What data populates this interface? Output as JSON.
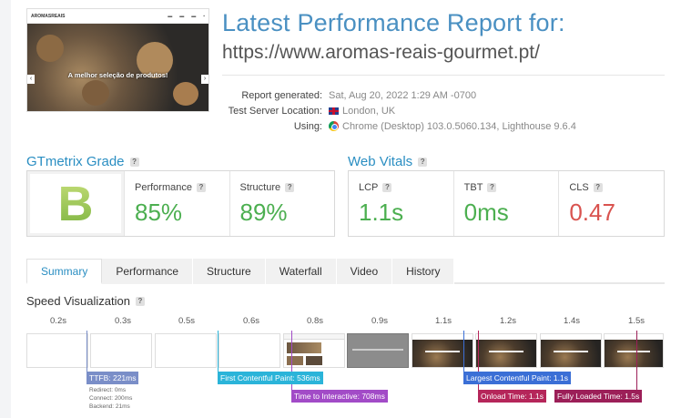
{
  "thumbnail": {
    "logo": "AROMASREAIS",
    "nav_links": [
      "",
      "",
      ""
    ],
    "hero_text": "A melhor seleção de produtos!"
  },
  "header": {
    "title": "Latest Performance Report for:",
    "url": "https://www.aromas-reais-gourmet.pt/"
  },
  "meta": {
    "report_generated_label": "Report generated:",
    "report_generated_value": "Sat, Aug 20, 2022 1:29 AM -0700",
    "server_label": "Test Server Location:",
    "server_value": "London, UK",
    "using_label": "Using:",
    "using_value": "Chrome (Desktop) 103.0.5060.134, Lighthouse 9.6.4"
  },
  "grade": {
    "title": "GTmetrix Grade",
    "letter": "B",
    "performance_label": "Performance",
    "performance_value": "85%",
    "structure_label": "Structure",
    "structure_value": "89%"
  },
  "vitals": {
    "title": "Web Vitals",
    "lcp_label": "LCP",
    "lcp_value": "1.1s",
    "tbt_label": "TBT",
    "tbt_value": "0ms",
    "cls_label": "CLS",
    "cls_value": "0.47"
  },
  "tabs": [
    "Summary",
    "Performance",
    "Structure",
    "Waterfall",
    "Video",
    "History"
  ],
  "speed_viz": {
    "title": "Speed Visualization",
    "ticks": [
      "0.2s",
      "0.3s",
      "0.5s",
      "0.6s",
      "0.8s",
      "0.9s",
      "1.1s",
      "1.2s",
      "1.4s",
      "1.5s"
    ],
    "markers": {
      "ttfb": "TTFB: 221ms",
      "fcp": "First Contentful Paint: 536ms",
      "tti": "Time to Interactive: 708ms",
      "lcp": "Largest Contentful Paint: 1.1s",
      "onload": "Onload Time: 1.1s",
      "fully_loaded": "Fully Loaded Time: 1.5s"
    },
    "ttfb_details": {
      "redirect": "Redirect: 0ms",
      "connect": "Connect: 200ms",
      "backend": "Backend: 21ms"
    }
  },
  "colors": {
    "accent": "#2a8ec2",
    "ttfb": "#7a8ec8",
    "fcp": "#2bb4d9",
    "tti": "#a24bc7",
    "lcp": "#3b6fd6",
    "onload": "#b5265a",
    "fully_loaded": "#9c1f58"
  },
  "icons": {
    "help": "question-mark-icon",
    "flag": "uk-flag-icon",
    "browser": "chrome-icon"
  }
}
